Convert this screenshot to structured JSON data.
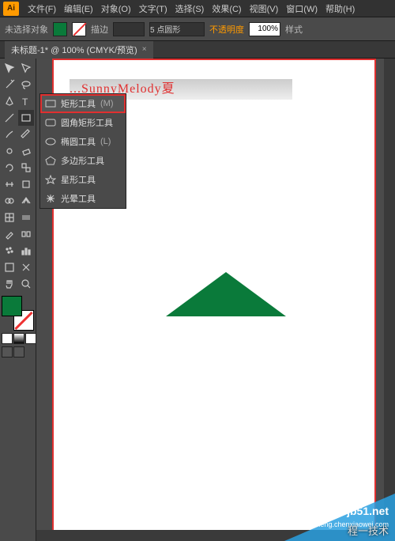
{
  "app_icon": "Ai",
  "menus": [
    "文件(F)",
    "编辑(E)",
    "对象(O)",
    "文字(T)",
    "选择(S)",
    "效果(C)",
    "视图(V)",
    "窗口(W)",
    "帮助(H)"
  ],
  "options": {
    "no_selection": "未选择对象",
    "stroke_label": "描边",
    "stroke_weight": "",
    "shape_select": "5 点圆形",
    "opacity_label": "不透明度",
    "opacity_value": "100%",
    "style_label": "样式"
  },
  "tab": {
    "title": "未标题-1* @ 100% (CMYK/预览)"
  },
  "flyout": {
    "items": [
      {
        "label": "矩形工具",
        "key": "(M)",
        "icon": "rect"
      },
      {
        "label": "圆角矩形工具",
        "key": "",
        "icon": "roundrect"
      },
      {
        "label": "椭圆工具",
        "key": "(L)",
        "icon": "ellipse"
      },
      {
        "label": "多边形工具",
        "key": "",
        "icon": "polygon"
      },
      {
        "label": "星形工具",
        "key": "",
        "icon": "star"
      },
      {
        "label": "光晕工具",
        "key": "",
        "icon": "flare"
      }
    ]
  },
  "canvas": {
    "banner_text": "...SunnyMelody夏"
  },
  "watermark": {
    "site": "jb51.net",
    "sub": "jiaocheng.chenxiaowei.com",
    "cn": "程一技术"
  },
  "colors": {
    "fill": "#0a7a3a",
    "highlight": "#e03030"
  }
}
